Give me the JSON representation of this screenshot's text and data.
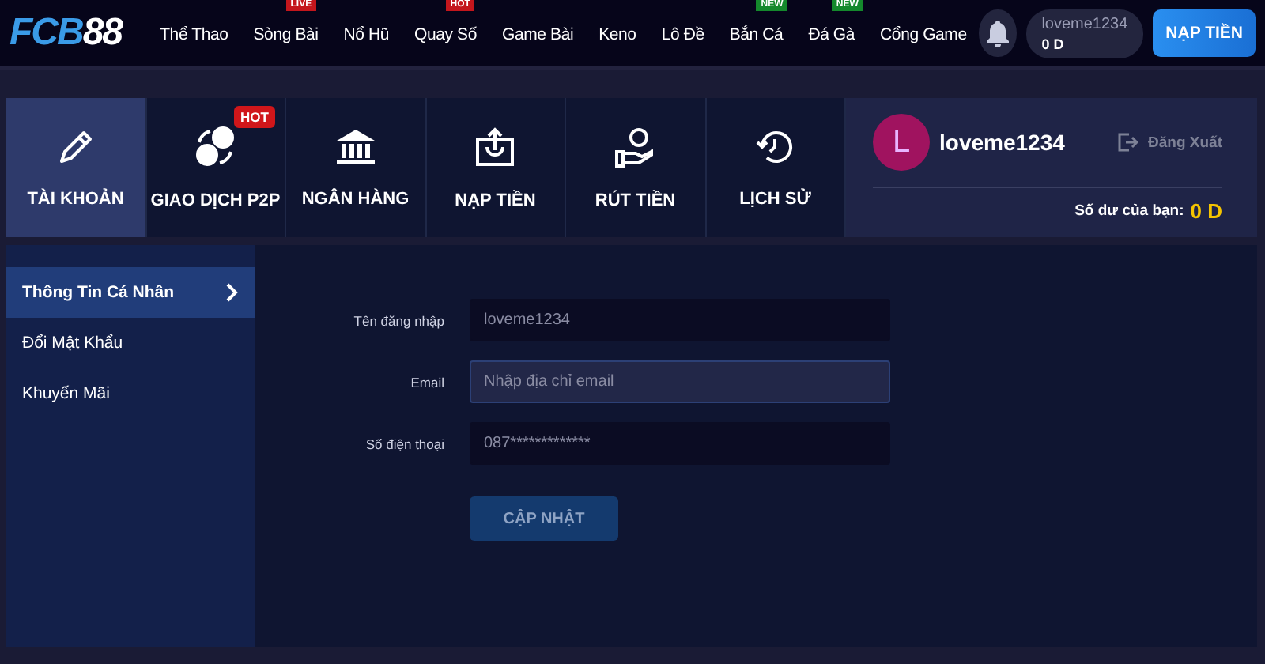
{
  "header": {
    "logo": {
      "part_1": "FCB",
      "part_2": "88"
    },
    "nav": [
      {
        "label": "Thể Thao"
      },
      {
        "label": "Sòng Bài",
        "badge": {
          "text": "LIVE",
          "color": "#c4161c"
        }
      },
      {
        "label": "Nổ Hũ"
      },
      {
        "label": "Quay Số",
        "badge": {
          "text": "HOT",
          "color": "#c4161c"
        }
      },
      {
        "label": "Game Bài"
      },
      {
        "label": "Keno"
      },
      {
        "label": "Lô Đề"
      },
      {
        "label": "Bắn Cá",
        "badge": {
          "text": "NEW",
          "color": "#14892c"
        }
      },
      {
        "label": "Đá Gà",
        "badge": {
          "text": "NEW",
          "color": "#14892c"
        }
      },
      {
        "label": "Cổng Game"
      }
    ],
    "account": {
      "username": "loveme1234",
      "balance": "0 D"
    },
    "deposit_button": "NẠP TIỀN"
  },
  "tabs": [
    {
      "label": "TÀI KHOẢN",
      "selected": true
    },
    {
      "label": "GIAO DỊCH P2P",
      "selected": false,
      "badge": "HOT"
    },
    {
      "label": "NGÂN HÀNG",
      "selected": false
    },
    {
      "label": "NẠP TIỀN",
      "selected": false
    },
    {
      "label": "RÚT TIỀN",
      "selected": false
    },
    {
      "label": "LỊCH SỬ",
      "selected": false
    }
  ],
  "user_panel": {
    "avatar_letter": "L",
    "username": "loveme1234",
    "logout": "Đăng Xuất",
    "balance_label": "Số dư của bạn:",
    "balance": "0 D"
  },
  "sidebar": {
    "items": [
      {
        "label": "Thông Tin Cá Nhân",
        "selected": true
      },
      {
        "label": "Đổi Mật Khẩu",
        "selected": false
      },
      {
        "label": "Khuyến Mãi",
        "selected": false
      }
    ]
  },
  "form": {
    "fields": [
      {
        "label": "Tên đăng nhập",
        "value": "loveme1234",
        "focused": false
      },
      {
        "label": "Email",
        "placeholder": "Nhập địa chỉ email",
        "focused": true
      },
      {
        "label": "Số điện thoại",
        "value": "087*************",
        "focused": false
      }
    ],
    "submit": "CẬP NHẬT"
  }
}
